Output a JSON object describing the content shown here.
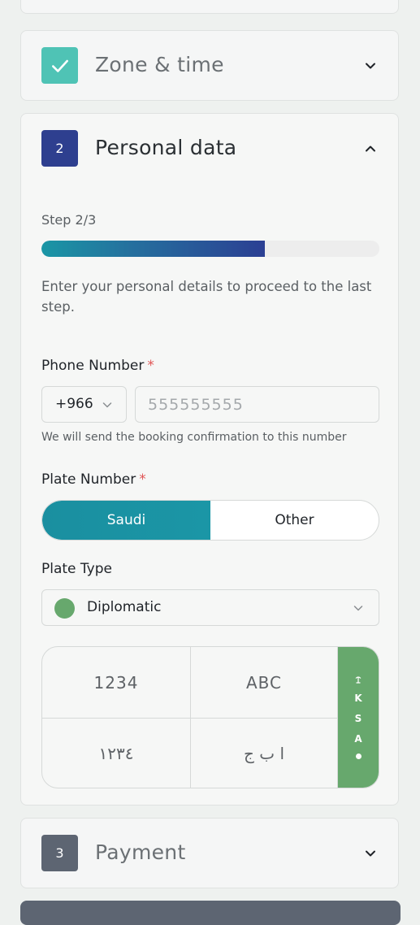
{
  "steps": {
    "zone": {
      "title": "Zone & time",
      "status": "completed"
    },
    "personal": {
      "number": "2",
      "title": "Personal data"
    },
    "payment": {
      "number": "3",
      "title": "Payment"
    }
  },
  "personal": {
    "step_label": "Step 2/3",
    "progress": 0.66,
    "intro": "Enter your personal details to proceed to the last step.",
    "phone": {
      "label": "Phone Number",
      "required_mark": "*",
      "country_code": "+966",
      "placeholder": "555555555",
      "hint": "We will send the booking confirmation to this number"
    },
    "plate_number": {
      "label": "Plate Number",
      "required_mark": "*",
      "options": [
        "Saudi",
        "Other"
      ],
      "selected": "Saudi"
    },
    "plate_type": {
      "label": "Plate Type",
      "value": "Diplomatic",
      "dot_color": "#67a86d"
    },
    "plate": {
      "latin_numbers": "1234",
      "latin_letters": "ABC",
      "arabic_numbers": "١٢٣٤",
      "arabic_letters": "ا ب ج",
      "country_letters": [
        "K",
        "S",
        "A"
      ],
      "band_color": "#67a86d"
    }
  },
  "colors": {
    "accent_teal": "#1b96a6",
    "accent_navy": "#2e3f8f",
    "completed_badge": "#4fc3b5",
    "pending_badge": "#5d6572",
    "required": "#e05555"
  }
}
